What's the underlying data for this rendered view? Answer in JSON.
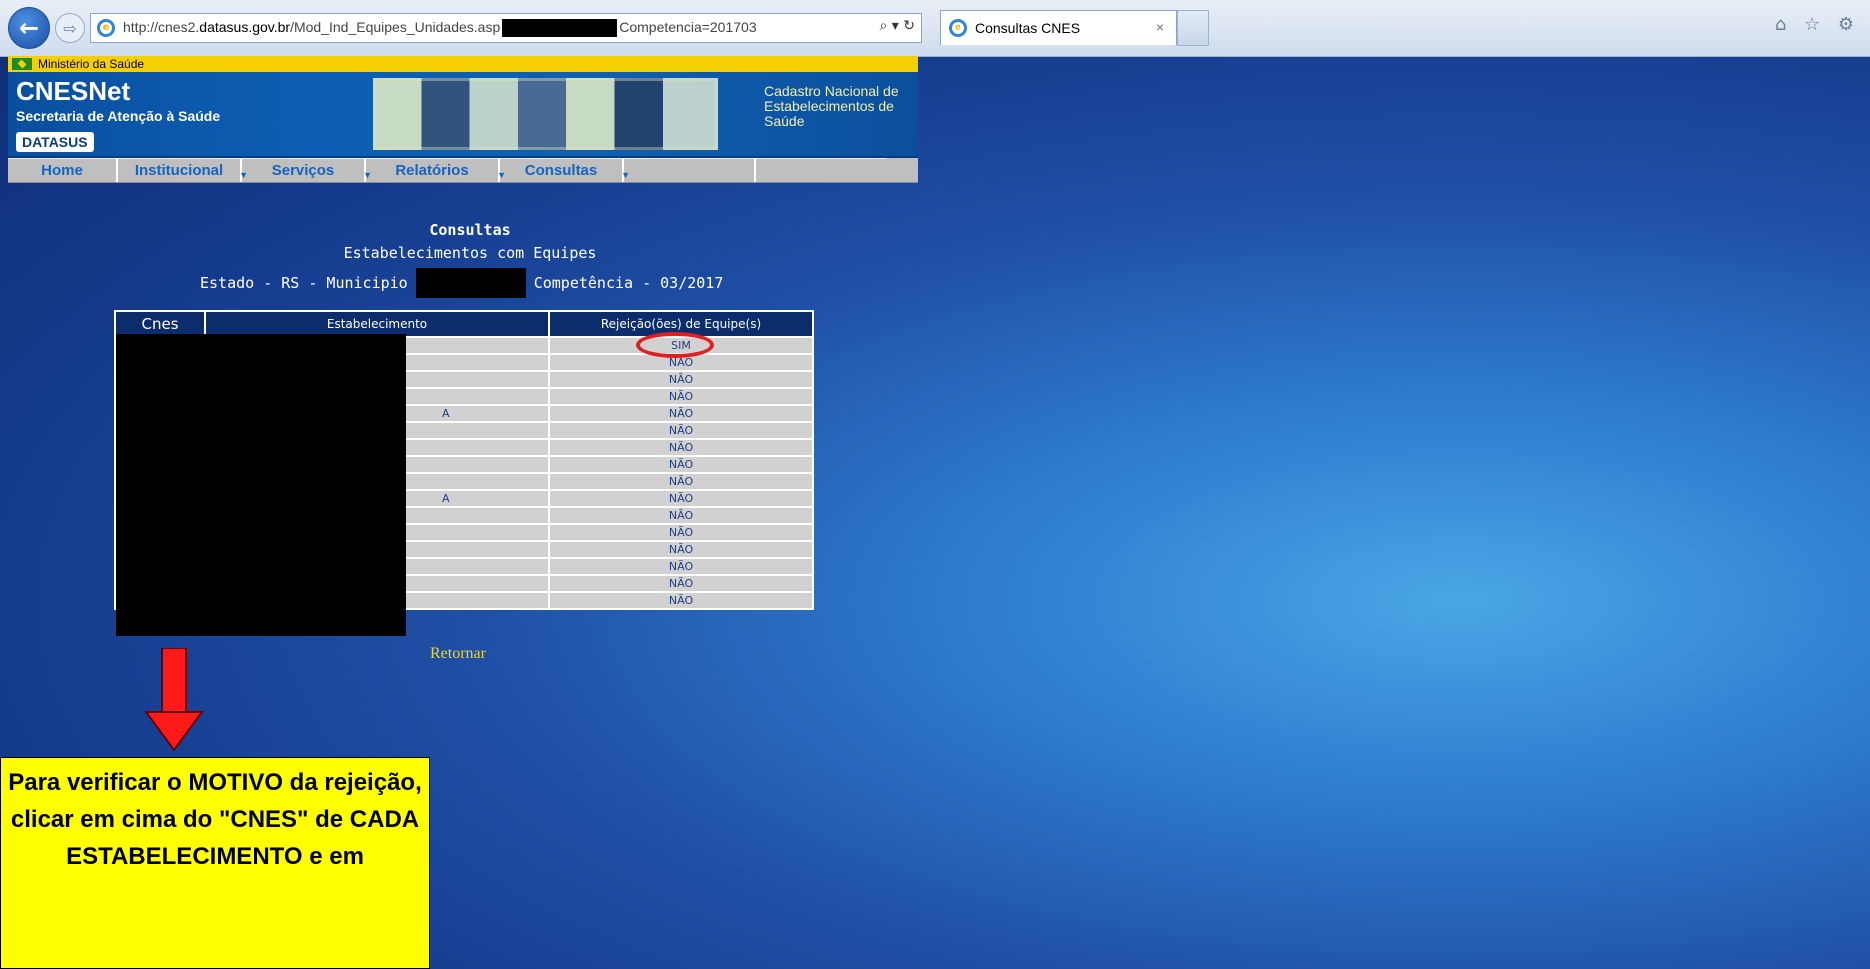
{
  "browser": {
    "url_prefix": "http://cnes2.",
    "url_host": "datasus.gov.br",
    "url_path": "/Mod_Ind_Equipes_Unidades.asp",
    "url_suffix": "Competencia=201703",
    "address_controls": "⌕ ▾ ↻",
    "tab_title": "Consultas CNES",
    "tab_close": "×",
    "toolbar_icons": "⌂ ☆ ⚙"
  },
  "site": {
    "ministry": "Ministério da Saúde",
    "logo": "CNESNet",
    "subtitle": "Secretaria de Atenção à Saúde",
    "datasus": "DATASUS",
    "header_right": "Cadastro Nacional de Estabelecimentos de Saúde",
    "menu": [
      {
        "label": "Home"
      },
      {
        "label": "Institucional"
      },
      {
        "label": "Serviços"
      },
      {
        "label": "Relatórios"
      },
      {
        "label": "Consultas"
      }
    ]
  },
  "content": {
    "title": "Consultas",
    "subtitle": "Estabelecimentos com Equipes",
    "location_prefix": "Estado - RS - Municipio",
    "competencia": "Competência - 03/2017"
  },
  "table": {
    "headers": [
      "Cnes",
      "Estabelecimento",
      "Rejeição(ões) de Equipe(s)"
    ],
    "rejections": [
      "SIM",
      "NÃO",
      "NÃO",
      "NÃO",
      "NÃO",
      "NÃO",
      "NÃO",
      "NÃO",
      "NÃO",
      "NÃO",
      "NÃO",
      "NÃO",
      "NÃO",
      "NÃO",
      "NÃO",
      "NÃO"
    ],
    "visible_name_fragments": {
      "4": "A",
      "9": "A"
    }
  },
  "retornar": "Retornar",
  "note": "Para verificar o MOTIVO da rejeição, clicar em cima do \"CNES\" de CADA ESTABELECIMENTO e em",
  "colors": {
    "accent_red": "#e02020",
    "note_yellow": "#ffff00",
    "table_header": "#0c2d6b"
  }
}
